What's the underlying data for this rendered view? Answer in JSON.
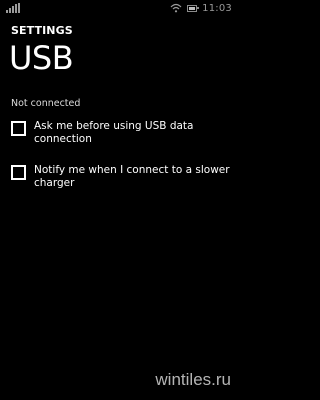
{
  "status_bar": {
    "time": "11:03",
    "signal_icon": "cell-signal-icon",
    "wifi_icon": "wifi-icon",
    "battery_icon": "battery-icon"
  },
  "header": {
    "section": "SETTINGS",
    "title": "USB"
  },
  "main": {
    "status_text": "Not connected",
    "options": [
      {
        "label": "Ask me before using USB data connection",
        "checked": false
      },
      {
        "label": "Notify me when I connect to a slower charger",
        "checked": false
      }
    ]
  },
  "watermark": "wintiles.ru",
  "colors": {
    "background": "#000000",
    "foreground": "#ffffff",
    "dim": "#9a9a9a"
  }
}
